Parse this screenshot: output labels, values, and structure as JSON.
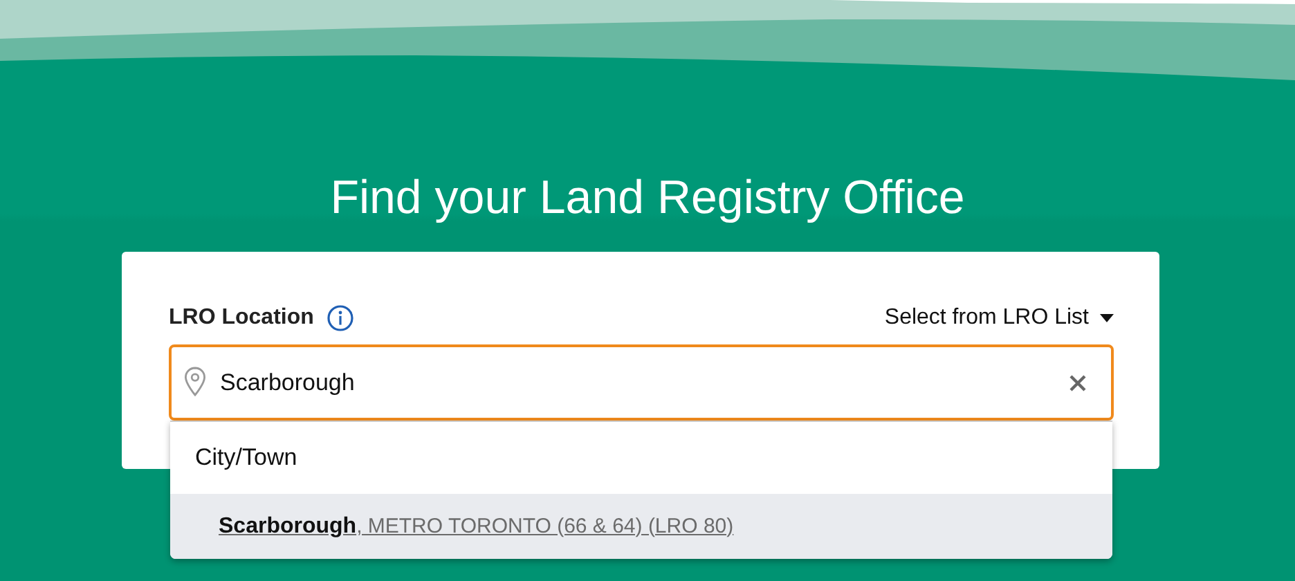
{
  "header": {
    "title": "Find your Land Registry Office"
  },
  "search": {
    "label": "LRO Location",
    "list_link": "Select from LRO List",
    "value": "Scarborough",
    "focused": true,
    "suggestions": {
      "group": "City/Town",
      "items": [
        {
          "text": "**Scarborough**, METRO TORONTO (66 & 64) (LRO 80)",
          "selected": true
        }
      ]
    }
  }
}
